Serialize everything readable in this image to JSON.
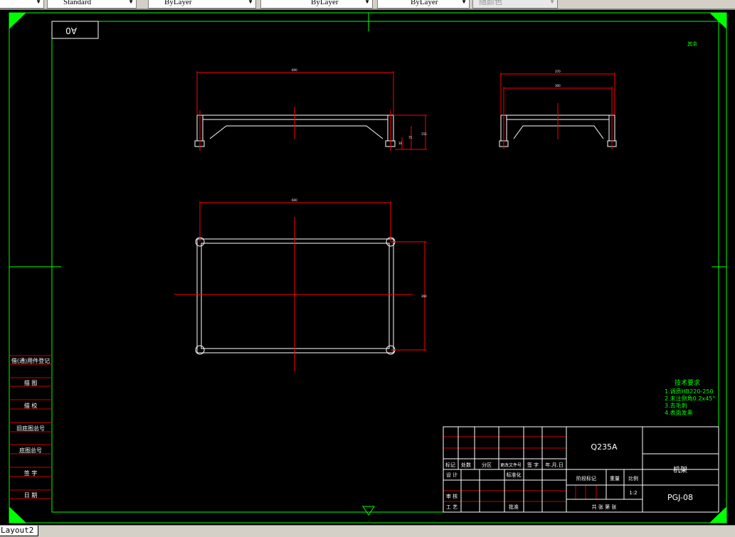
{
  "toolbar": {
    "dropdowns": [
      {
        "value": "",
        "name": "layer-dropdown"
      },
      {
        "value": "Standard",
        "name": "plotstyle-dropdown"
      },
      {
        "value": "ByLayer",
        "name": "color-dropdown"
      },
      {
        "value": "ByLayer",
        "name": "linetype-dropdown"
      },
      {
        "value": "ByLayer",
        "name": "lineweight-dropdown"
      },
      {
        "value": "随颜色",
        "name": "plotstyle-color-dropdown"
      }
    ]
  },
  "drawing": {
    "sheet_label": "A0",
    "corner_note": "其余",
    "dims": {
      "top_len": "600",
      "side_h1": "75",
      "side_h2": "30",
      "side_h3": "155",
      "right_w1": "370",
      "right_w2": "300",
      "plan_len": "600",
      "plan_w": "360"
    },
    "tech_req": {
      "title": "技术要求",
      "items": [
        "1.调质HB220-250",
        "2.未注倒角0.2x45°",
        "3.去毛刺",
        "4.表面发黑"
      ]
    },
    "left_table": [
      "借(通)用件登记",
      "描 图",
      "描 校",
      "旧底图总号",
      "底图总号",
      "签 字",
      "日 期"
    ],
    "title_block": {
      "material": "Q235A",
      "part_name": "机架",
      "drawing_no": "PGJ-08",
      "headers": [
        "标记",
        "处数",
        "分区",
        "更改文件号",
        "签 字",
        "年.月.日"
      ],
      "rows": [
        "设 计",
        "审 核",
        "工 艺"
      ],
      "std": "标准化",
      "approve": "批准",
      "stage": "阶段标记",
      "weight": "重量",
      "scale_label": "比例",
      "scale": "1:2",
      "sheets": "共  张  第  张"
    }
  },
  "tabs": {
    "active": "Layout2"
  },
  "colors": {
    "frame": "#00ff00",
    "geometry": "#ffffff",
    "dimension": "#ff0000",
    "centerline": "#ff0000"
  }
}
